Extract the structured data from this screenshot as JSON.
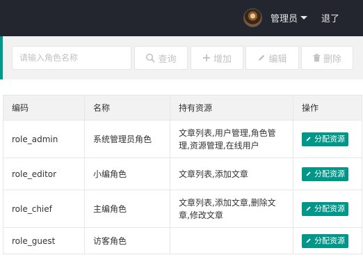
{
  "header": {
    "user_name": "管理员",
    "logout_label": "退了"
  },
  "toolbar": {
    "search_placeholder": "请输入角色名称",
    "query_label": "查询",
    "add_label": "增加",
    "edit_label": "编辑",
    "delete_label": "删除"
  },
  "table": {
    "headers": [
      "编码",
      "名称",
      "持有资源",
      "操作"
    ],
    "action_label": "分配资源",
    "rows": [
      {
        "code": "role_admin",
        "name": "系统管理员角色",
        "resources_line1": "文章列表,用户管理,角色管",
        "resources_line2": "理,资源管理,在线用户"
      },
      {
        "code": "role_editor",
        "name": "小编角色",
        "resources_line1": "文章列表,添加文章",
        "resources_line2": ""
      },
      {
        "code": "role_chief",
        "name": "主编角色",
        "resources_line1": "文章列表,添加文章,删除文",
        "resources_line2": "章,修改文章"
      },
      {
        "code": "role_guest",
        "name": "访客角色",
        "resources_line1": "",
        "resources_line2": ""
      }
    ]
  },
  "colors": {
    "header_bg": "#23262e",
    "accent": "#009688",
    "toolbar_bg": "#f2f2f2"
  }
}
